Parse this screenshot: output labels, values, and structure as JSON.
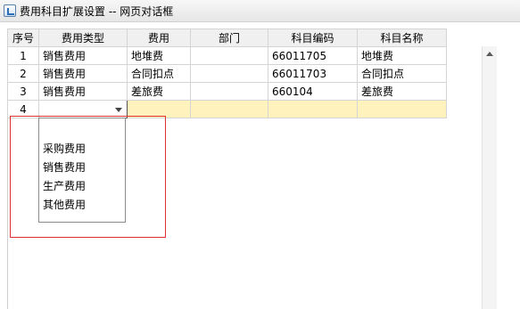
{
  "window": {
    "title": "费用科目扩展设置 -- 网页对话框"
  },
  "grid": {
    "columns": [
      "序号",
      "费用类型",
      "费用",
      "部门",
      "科目编码",
      "科目名称"
    ],
    "rows": [
      {
        "num": "1",
        "type": "销售费用",
        "expense": "地堆费",
        "dept": "",
        "code": "66011705",
        "name": "地堆费"
      },
      {
        "num": "2",
        "type": "销售费用",
        "expense": "合同扣点",
        "dept": "",
        "code": "66011703",
        "name": "合同扣点"
      },
      {
        "num": "3",
        "type": "销售费用",
        "expense": "差旅费",
        "dept": "",
        "code": "660104",
        "name": "差旅费"
      }
    ],
    "edit_row": {
      "num": "4",
      "selected_type": ""
    }
  },
  "dropdown": {
    "options": [
      "采购费用",
      "销售费用",
      "生产费用",
      "其他费用"
    ]
  },
  "colors": {
    "highlight": "#e03030",
    "edit_row": "#fff2bd",
    "header_bg": "#f0f0f0"
  }
}
